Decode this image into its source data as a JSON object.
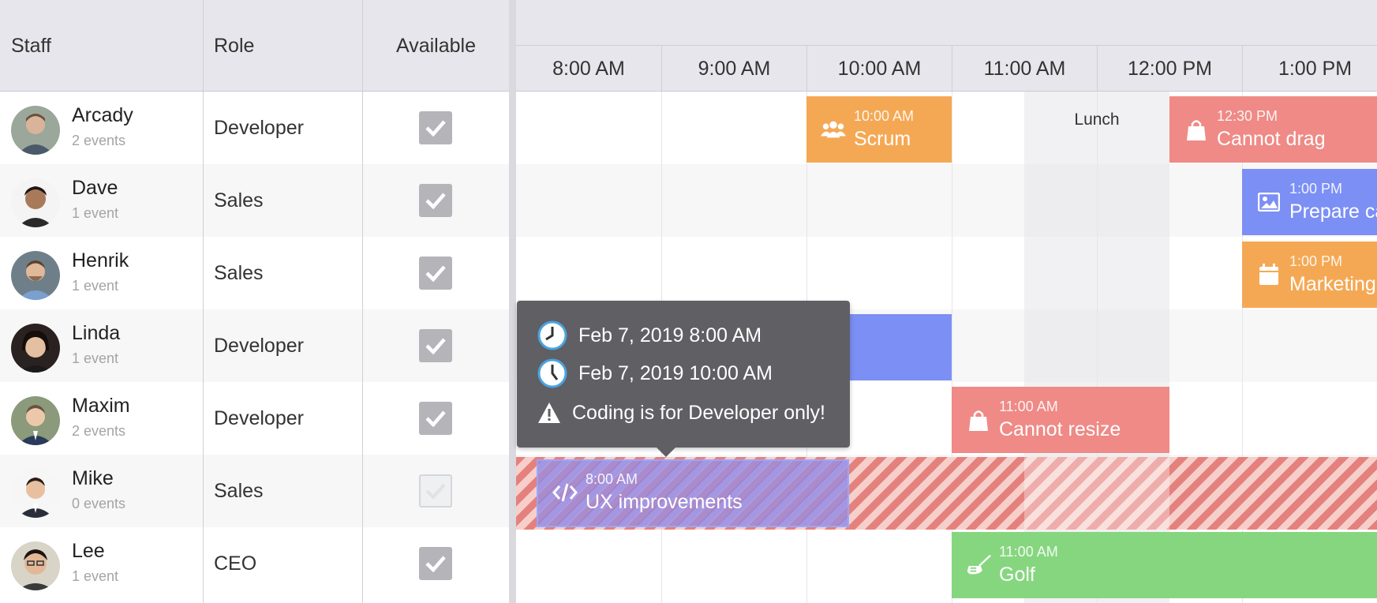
{
  "columns": {
    "staff": "Staff",
    "role": "Role",
    "available": "Available"
  },
  "staff": [
    {
      "name": "Arcady",
      "events": "2 events",
      "role": "Developer",
      "available": true,
      "avatar": "man-light-short-hair"
    },
    {
      "name": "Dave",
      "events": "1 event",
      "role": "Sales",
      "available": true,
      "avatar": "man-dark-hair"
    },
    {
      "name": "Henrik",
      "events": "1 event",
      "role": "Sales",
      "available": true,
      "avatar": "man-beard"
    },
    {
      "name": "Linda",
      "events": "1 event",
      "role": "Developer",
      "available": true,
      "avatar": "woman-dark-hair"
    },
    {
      "name": "Maxim",
      "events": "2 events",
      "role": "Developer",
      "available": true,
      "avatar": "man-suit"
    },
    {
      "name": "Mike",
      "events": "0 events",
      "role": "Sales",
      "available": false,
      "avatar": "man-smiling"
    },
    {
      "name": "Lee",
      "events": "1 event",
      "role": "CEO",
      "available": true,
      "avatar": "man-glasses"
    }
  ],
  "timeaxis": [
    "8:00 AM",
    "9:00 AM",
    "10:00 AM",
    "11:00 AM",
    "12:00 PM",
    "1:00 PM"
  ],
  "lunch": "Lunch",
  "events": {
    "scrum": {
      "time": "10:00 AM",
      "name": "Scrum",
      "color": "#f5a854",
      "icon": "users-icon"
    },
    "cannotdrag": {
      "time": "12:30 PM",
      "name": "Cannot drag",
      "color": "#ef8a86",
      "icon": "shopping-bag-icon"
    },
    "prepare": {
      "time": "1:00 PM",
      "name": "Prepare campaign",
      "color": "#7b8ff5",
      "icon": "image-icon"
    },
    "marketing": {
      "time": "1:00 PM",
      "name": "Marketing",
      "color": "#f5a854",
      "icon": "calendar-icon"
    },
    "linda": {
      "color": "#7b8ff5"
    },
    "cannotresize": {
      "time": "11:00 AM",
      "name": "Cannot resize",
      "color": "#ef8a86",
      "icon": "shopping-bag-icon"
    },
    "ux": {
      "time": "8:00 AM",
      "name": "UX improvements",
      "color": "#8a8ae8",
      "icon": "code-icon"
    },
    "golf": {
      "time": "11:00 AM",
      "name": "Golf",
      "color": "#86d67f",
      "icon": "golf-icon"
    }
  },
  "tooltip": {
    "start": "Feb 7, 2019 8:00 AM",
    "end": "Feb 7, 2019 10:00 AM",
    "warning": "Coding is for Developer only!"
  },
  "colors": {
    "header_bg": "#e6e6ec",
    "tooltip_bg": "#5f5f64",
    "clock_blue": "#4aa3df"
  }
}
